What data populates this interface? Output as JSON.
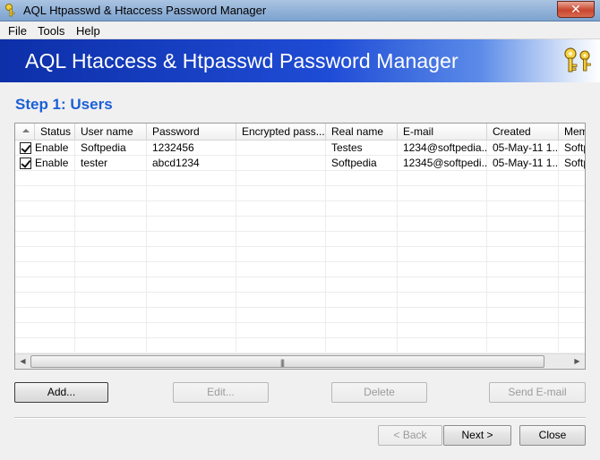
{
  "window": {
    "title": "AQL Htpasswd & Htaccess Password Manager",
    "close_glyph": "✕"
  },
  "menu": {
    "items": [
      "File",
      "Tools",
      "Help"
    ]
  },
  "banner": {
    "title": "AQL Htaccess & Htpasswd Password Manager",
    "icon": "keys-icon"
  },
  "step": {
    "title": "Step 1: Users"
  },
  "grid": {
    "columns": [
      "Status",
      "User name",
      "Password",
      "Encrypted pass...",
      "Real name",
      "E-mail",
      "Created",
      "Memo"
    ],
    "rows": [
      {
        "checked": true,
        "status": "Enable",
        "username": "Softpedia",
        "password": "1232456",
        "encrypted": "",
        "realname": "Testes",
        "email": "1234@softpedia....",
        "created": "05-May-11 1...",
        "memo": "Softp"
      },
      {
        "checked": true,
        "status": "Enable",
        "username": "tester",
        "password": "abcd1234",
        "encrypted": "",
        "realname": "Softpedia",
        "email": "12345@softpedi...",
        "created": "05-May-11 1...",
        "memo": "Softp"
      }
    ],
    "scroll_grip": "|||"
  },
  "actions": {
    "add": "Add...",
    "edit": "Edit...",
    "delete": "Delete",
    "send_email": "Send E-mail"
  },
  "nav": {
    "back": "< Back",
    "next": "Next >",
    "close": "Close"
  },
  "colors": {
    "banner_start": "#0d2fa8",
    "step_title": "#1a5fd6"
  }
}
